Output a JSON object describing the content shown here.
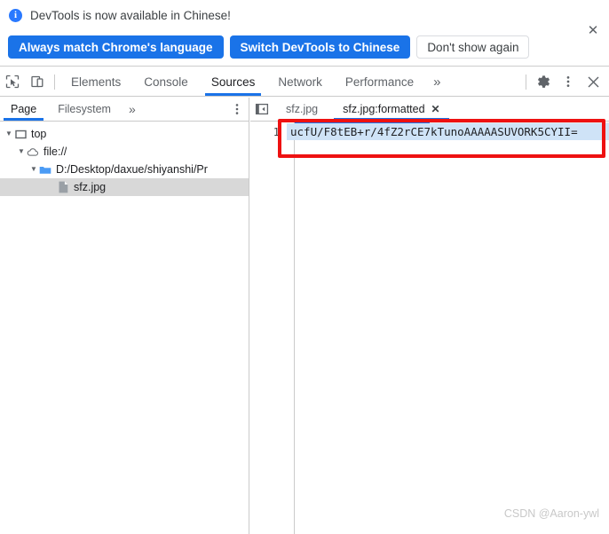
{
  "infobar": {
    "icon": "info-icon",
    "message": "DevTools is now available in Chinese!",
    "buttons": [
      {
        "label": "Always match Chrome's language",
        "style": "primary"
      },
      {
        "label": "Switch DevTools to Chinese",
        "style": "primary"
      },
      {
        "label": "Don't show again",
        "style": "secondary"
      }
    ],
    "close_label": "✕"
  },
  "toolbar": {
    "inspect_icon": "inspect-cursor-icon",
    "device_icon": "device-toolbar-icon",
    "tabs": [
      {
        "label": "Elements",
        "active": false
      },
      {
        "label": "Console",
        "active": false
      },
      {
        "label": "Sources",
        "active": true
      },
      {
        "label": "Network",
        "active": false
      },
      {
        "label": "Performance",
        "active": false
      }
    ],
    "overflow_label": "»",
    "settings_icon": "gear-icon",
    "menu_icon": "kebab-menu-icon",
    "close_icon": "close-icon",
    "close_label": "✕"
  },
  "navigator": {
    "tabs": [
      {
        "label": "Page",
        "active": true
      },
      {
        "label": "Filesystem",
        "active": false
      }
    ],
    "overflow_label": "»",
    "menu_icon": "kebab-menu-icon",
    "tree": [
      {
        "label": "top",
        "icon": "frame-icon",
        "depth": 0,
        "expanded": true,
        "selected": false
      },
      {
        "label": "file://",
        "icon": "cloud-icon",
        "depth": 1,
        "expanded": true,
        "selected": false
      },
      {
        "label": "D:/Desktop/daxue/shiyanshi/Pr",
        "icon": "folder-icon",
        "depth": 2,
        "expanded": true,
        "selected": false
      },
      {
        "label": "sfz.jpg",
        "icon": "file-icon",
        "depth": 3,
        "expanded": false,
        "selected": true
      }
    ]
  },
  "editor": {
    "nav_button_icon": "show-navigator-icon",
    "tabs": [
      {
        "label": "sfz.jpg",
        "active": false,
        "closable": false
      },
      {
        "label": "sfz.jpg:formatted",
        "active": true,
        "closable": true
      }
    ],
    "close_label": "✕",
    "code": {
      "line_number": "1",
      "line_text": "ucfU/F8tEB+r/4fZ2rCE7kTunoAAAAASUVORK5CYII="
    }
  },
  "annotation": {
    "color": "#ee1111",
    "name": "red-highlight-box"
  },
  "watermark": {
    "text": "CSDN @Aaron-ywl"
  },
  "colors": {
    "accent": "#1a73e8",
    "primary_button": "#1a73e8",
    "selection": "#cfe3f7",
    "selected_row": "#d8d8d8",
    "annotation": "#ee1111"
  }
}
